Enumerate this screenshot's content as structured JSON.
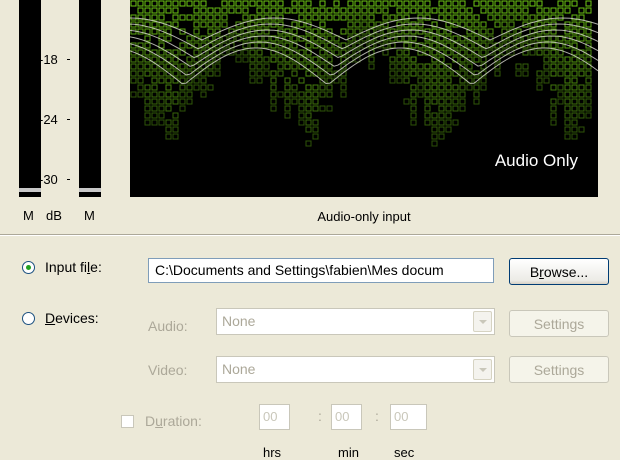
{
  "meters": {
    "scale": [
      "-18",
      "-24",
      "-30"
    ],
    "left_label": "M",
    "unit_label": "dB",
    "right_label": "M"
  },
  "visualization": {
    "badge": "Audio Only",
    "caption": "Audio-only input"
  },
  "source": {
    "input_file": {
      "label_pre": "Input fi",
      "label_accel": "l",
      "label_post": "e:",
      "selected": true,
      "path": "C:\\Documents and Settings\\fabien\\Mes docum",
      "browse_pre": "B",
      "browse_accel": "r",
      "browse_post": "owse..."
    },
    "devices": {
      "label_accel": "D",
      "label_post": "evices:",
      "selected": false
    },
    "audio": {
      "label": "Audio:",
      "value": "None",
      "settings": "Settings"
    },
    "video": {
      "label": "Video:",
      "value": "None",
      "settings": "Settings"
    },
    "duration": {
      "label_pre": "D",
      "label_accel": "u",
      "label_post": "ration:",
      "checked": false,
      "hours": "00",
      "minutes": "00",
      "seconds": "00",
      "unit_hours": "hrs",
      "unit_minutes": "min",
      "unit_seconds": "sec"
    }
  },
  "colors": {
    "accent_green": "#8ec426",
    "window_bg": "#ece9d8",
    "disabled_text": "#aca899"
  }
}
